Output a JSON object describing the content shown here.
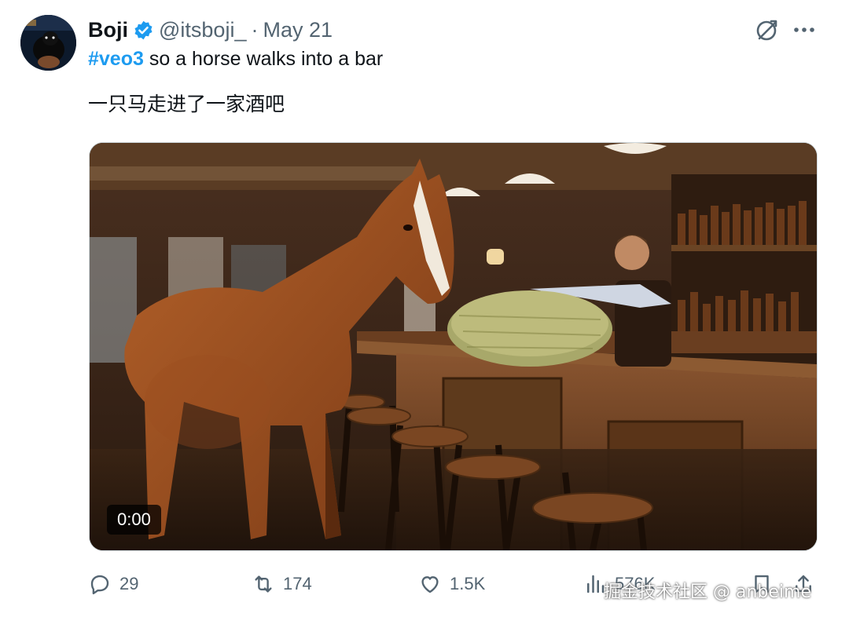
{
  "author": {
    "name": "Boji",
    "handle": "@itsboji_",
    "separator": "·",
    "date": "May 21"
  },
  "tweet": {
    "hashtag": "#veo3",
    "line1_rest": " so a horse walks into a bar",
    "line2": "一只马走进了一家酒吧"
  },
  "media": {
    "time": "0:00"
  },
  "actions": {
    "replies": "29",
    "reposts": "174",
    "likes": "1.5K",
    "views": "576K"
  },
  "watermark": "掘金技术社区 @ anbeime",
  "colors": {
    "accent": "#1d9bf0",
    "muted": "#536471",
    "text": "#0f1419"
  },
  "icons": [
    "verified-badge-icon",
    "grok-icon",
    "more-icon",
    "reply-icon",
    "repost-icon",
    "like-icon",
    "views-icon",
    "bookmark-icon",
    "share-icon"
  ]
}
